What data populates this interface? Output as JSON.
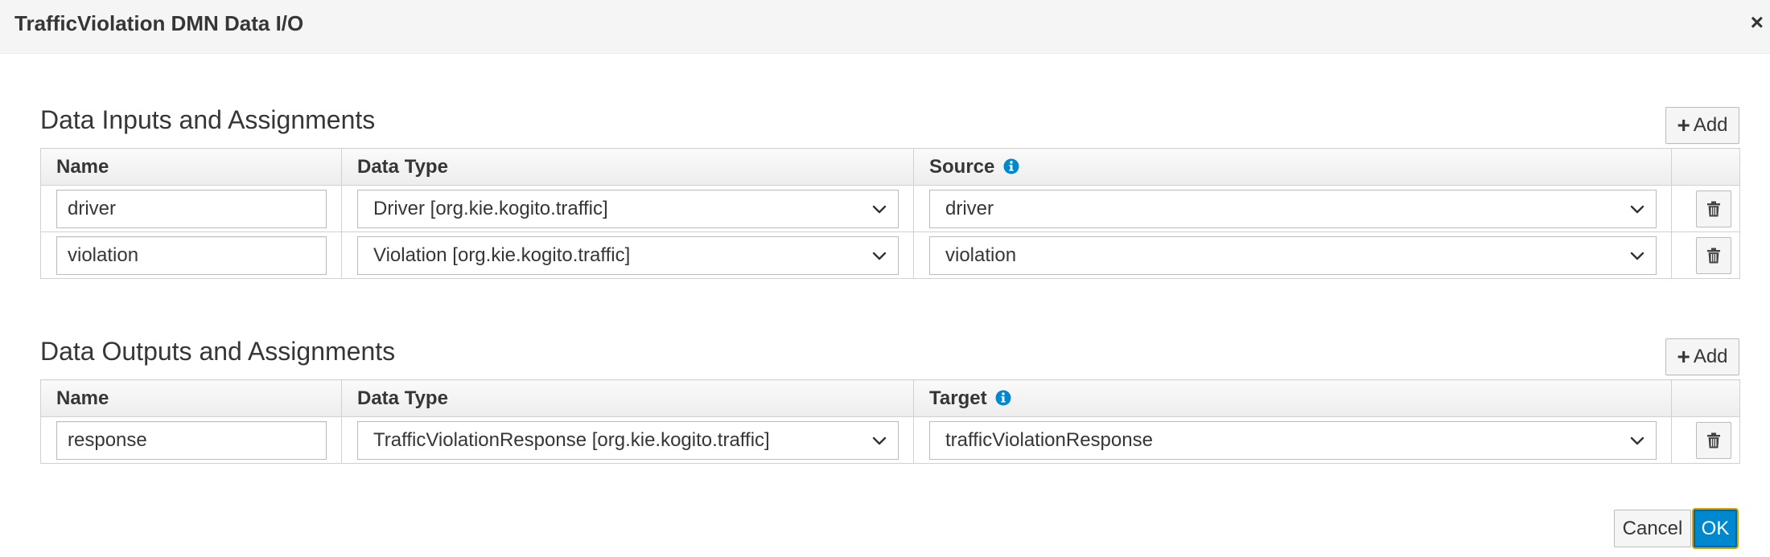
{
  "dialog": {
    "title": "TrafficViolation DMN Data I/O",
    "close_glyph": "×"
  },
  "inputs": {
    "title": "Data Inputs and Assignments",
    "add_label": "Add",
    "columns": {
      "name": "Name",
      "type": "Data Type",
      "source": "Source"
    },
    "rows": [
      {
        "name": "driver",
        "type": "Driver [org.kie.kogito.traffic]",
        "source": "driver"
      },
      {
        "name": "violation",
        "type": "Violation [org.kie.kogito.traffic]",
        "source": "violation"
      }
    ]
  },
  "outputs": {
    "title": "Data Outputs and Assignments",
    "add_label": "Add",
    "columns": {
      "name": "Name",
      "type": "Data Type",
      "target": "Target"
    },
    "rows": [
      {
        "name": "response",
        "type": "TrafficViolationResponse [org.kie.kogito.traffic]",
        "target": "trafficViolationResponse"
      }
    ]
  },
  "footer": {
    "cancel_label": "Cancel",
    "ok_label": "OK"
  },
  "icons": {
    "add": "plus-icon",
    "delete": "trash-icon",
    "info": "info-icon",
    "select": "chevron-down-icon",
    "close": "close-icon"
  },
  "colors": {
    "primary": "#0088ce",
    "info": "#0088ce",
    "header_bg": "#f5f5f5"
  }
}
